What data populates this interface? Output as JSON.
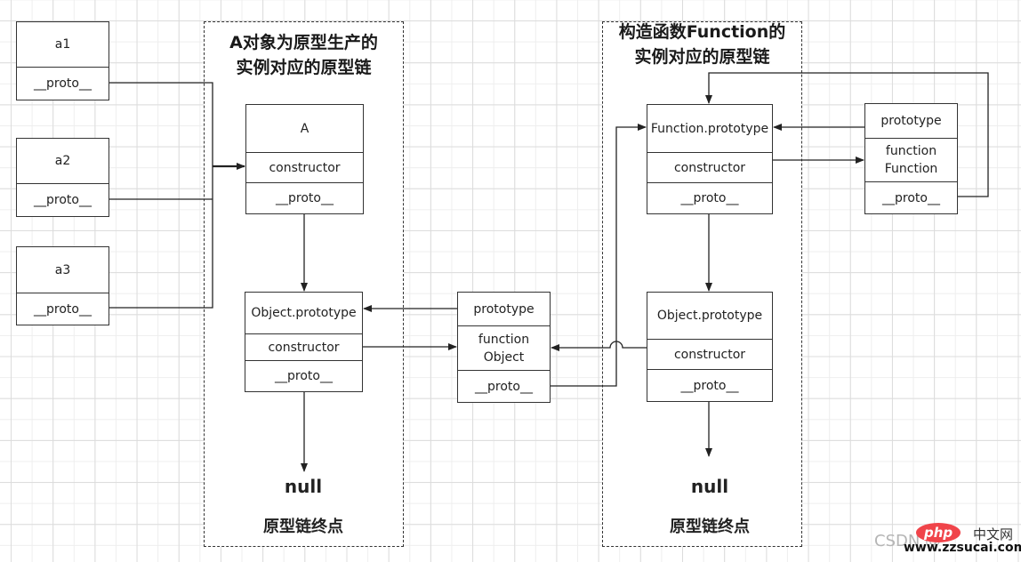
{
  "containers": {
    "left": {
      "title": "A对象为原型生产的\n实例对应的原型链",
      "null": "null",
      "end": "原型链终点"
    },
    "right": {
      "title": "构造函数Function的\n实例对应的原型链",
      "null": "null",
      "end": "原型链终点"
    }
  },
  "instances": [
    {
      "name": "a1",
      "proto": "__proto__"
    },
    {
      "name": "a2",
      "proto": "__proto__"
    },
    {
      "name": "a3",
      "proto": "__proto__"
    }
  ],
  "boxes": {
    "A": {
      "rows": [
        "A",
        "constructor",
        "__proto__"
      ]
    },
    "object_prototype_left": {
      "rows": [
        "Object.prototype",
        "constructor",
        "__proto__"
      ]
    },
    "function_object": {
      "rows": [
        "prototype",
        "function\nObject",
        "__proto__"
      ]
    },
    "function_prototype": {
      "rows": [
        "Function.prototype",
        "constructor",
        "__proto__"
      ]
    },
    "function_function": {
      "rows": [
        "prototype",
        "function\nFunction",
        "__proto__"
      ]
    },
    "object_prototype_right": {
      "rows": [
        "Object.prototype",
        "constructor",
        "__proto__"
      ]
    }
  },
  "watermark": {
    "csdn": "CSDN @",
    "php": "php",
    "cn": "中文网",
    "url": "www.zzsucai.com"
  }
}
